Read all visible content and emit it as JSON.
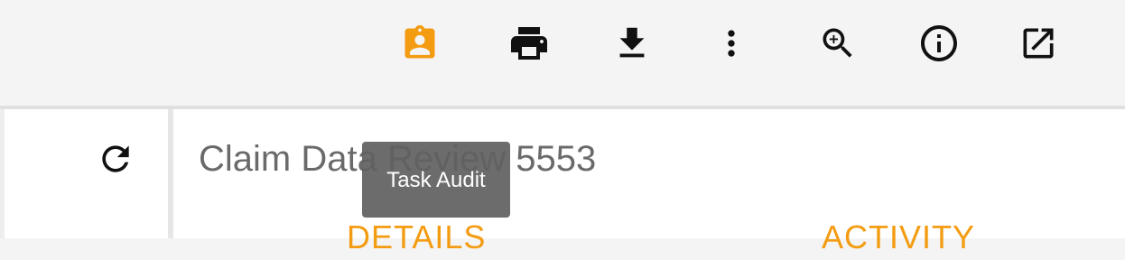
{
  "toolbar": {
    "accent_color": "#f39c12",
    "icons": [
      {
        "name": "assigned-user-badge-icon",
        "label": "Task Audit",
        "active": true
      },
      {
        "name": "print-icon"
      },
      {
        "name": "download-icon"
      },
      {
        "name": "more-vertical-icon"
      },
      {
        "name": "zoom-in-icon"
      },
      {
        "name": "info-icon"
      },
      {
        "name": "open-in-new-icon"
      }
    ]
  },
  "sidebar": {
    "refresh_icon": "refresh-icon"
  },
  "task": {
    "title": "Claim Data Review 5553"
  },
  "tabs": [
    {
      "label": "DETAILS"
    },
    {
      "label": "ACTIVITY"
    }
  ],
  "tooltip": {
    "text": "Task Audit"
  }
}
